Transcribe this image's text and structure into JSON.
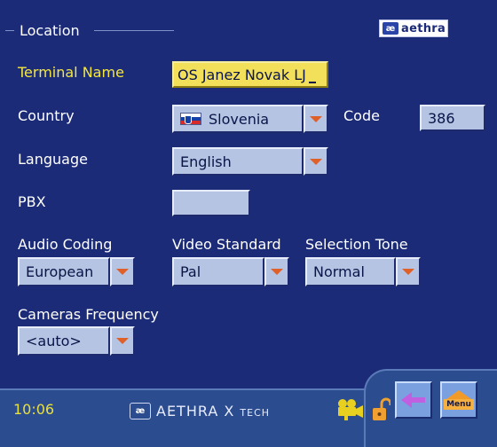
{
  "section": {
    "title": "Location"
  },
  "brand_logo": {
    "mark": "æ",
    "text": "aethra"
  },
  "fields": {
    "terminal_name": {
      "label": "Terminal Name",
      "value": "OS Janez Novak LJ"
    },
    "country": {
      "label": "Country",
      "value": "Slovenia",
      "flag": "slovenia-flag-icon"
    },
    "code": {
      "label": "Code",
      "value": "386"
    },
    "language": {
      "label": "Language",
      "value": "English"
    },
    "pbx": {
      "label": "PBX",
      "value": ""
    },
    "audio_coding": {
      "label": "Audio Coding",
      "value": "European"
    },
    "video_standard": {
      "label": "Video Standard",
      "value": "Pal"
    },
    "selection_tone": {
      "label": "Selection Tone",
      "value": "Normal"
    },
    "cameras_frequency": {
      "label": "Cameras Frequency",
      "value": "<auto>"
    }
  },
  "status_bar": {
    "time": "10:06",
    "brand_mark": "æ",
    "brand_text": "AETHRA X",
    "brand_suffix": "TECH",
    "menu_label": "Menu"
  },
  "colors": {
    "background": "#1b2b78",
    "field": "#b5c4e2",
    "active_field": "#f2e05a",
    "highlight_label": "#f4e640",
    "dropdown_arrow": "#e0602a",
    "bottom_bar": "#2b4c8e"
  }
}
